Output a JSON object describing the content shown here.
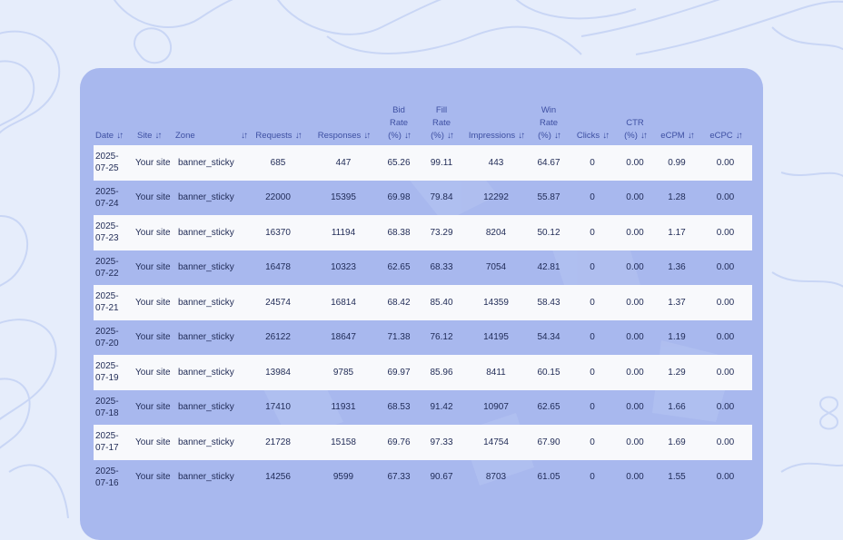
{
  "table": {
    "columns": [
      {
        "label": "Date",
        "lines": [
          "Date"
        ]
      },
      {
        "label": "Site",
        "lines": [
          "Site"
        ]
      },
      {
        "label": "Zone",
        "lines": [
          "Zone"
        ]
      },
      {
        "label": "Requests",
        "lines": [
          "Requests"
        ]
      },
      {
        "label": "Responses",
        "lines": [
          "Responses"
        ]
      },
      {
        "label": "Bid Rate (%)",
        "lines": [
          "Bid",
          "Rate",
          "(%)"
        ]
      },
      {
        "label": "Fill Rate (%)",
        "lines": [
          "Fill",
          "Rate",
          "(%)"
        ]
      },
      {
        "label": "Impressions",
        "lines": [
          "Impressions"
        ]
      },
      {
        "label": "Win Rate (%)",
        "lines": [
          "Win",
          "Rate",
          "(%)"
        ]
      },
      {
        "label": "Clicks",
        "lines": [
          "Clicks"
        ]
      },
      {
        "label": "CTR (%)",
        "lines": [
          "CTR",
          "(%)"
        ]
      },
      {
        "label": "eCPM",
        "lines": [
          "eCPM"
        ]
      },
      {
        "label": "eCPC",
        "lines": [
          "eCPC"
        ]
      }
    ],
    "sort_icon": "sort-arrows-icon",
    "rows": [
      [
        "2025-07-25",
        "Your site",
        "banner_sticky",
        "685",
        "447",
        "65.26",
        "99.11",
        "443",
        "64.67",
        "0",
        "0.00",
        "0.99",
        "0.00"
      ],
      [
        "2025-07-24",
        "Your site",
        "banner_sticky",
        "22000",
        "15395",
        "69.98",
        "79.84",
        "12292",
        "55.87",
        "0",
        "0.00",
        "1.28",
        "0.00"
      ],
      [
        "2025-07-23",
        "Your site",
        "banner_sticky",
        "16370",
        "11194",
        "68.38",
        "73.29",
        "8204",
        "50.12",
        "0",
        "0.00",
        "1.17",
        "0.00"
      ],
      [
        "2025-07-22",
        "Your site",
        "banner_sticky",
        "16478",
        "10323",
        "62.65",
        "68.33",
        "7054",
        "42.81",
        "0",
        "0.00",
        "1.36",
        "0.00"
      ],
      [
        "2025-07-21",
        "Your site",
        "banner_sticky",
        "24574",
        "16814",
        "68.42",
        "85.40",
        "14359",
        "58.43",
        "0",
        "0.00",
        "1.37",
        "0.00"
      ],
      [
        "2025-07-20",
        "Your site",
        "banner_sticky",
        "26122",
        "18647",
        "71.38",
        "76.12",
        "14195",
        "54.34",
        "0",
        "0.00",
        "1.19",
        "0.00"
      ],
      [
        "2025-07-19",
        "Your site",
        "banner_sticky",
        "13984",
        "9785",
        "69.97",
        "85.96",
        "8411",
        "60.15",
        "0",
        "0.00",
        "1.29",
        "0.00"
      ],
      [
        "2025-07-18",
        "Your site",
        "banner_sticky",
        "17410",
        "11931",
        "68.53",
        "91.42",
        "10907",
        "62.65",
        "0",
        "0.00",
        "1.66",
        "0.00"
      ],
      [
        "2025-07-17",
        "Your site",
        "banner_sticky",
        "21728",
        "15158",
        "69.76",
        "97.33",
        "14754",
        "67.90",
        "0",
        "0.00",
        "1.69",
        "0.00"
      ],
      [
        "2025-07-16",
        "Your site",
        "banner_sticky",
        "14256",
        "9599",
        "67.33",
        "90.67",
        "8703",
        "61.05",
        "0",
        "0.00",
        "1.55",
        "0.00"
      ]
    ]
  },
  "colors": {
    "background": "#e6edfb",
    "card": "#a8b8ee",
    "header_text": "#3d4fa2",
    "row_light": "#f8f9fc"
  }
}
